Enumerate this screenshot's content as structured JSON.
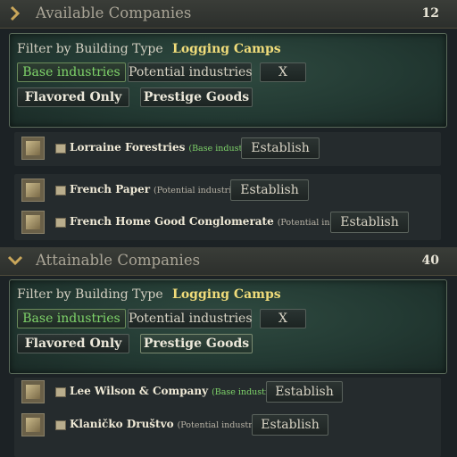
{
  "available": {
    "title": "Available Companies",
    "count": "12",
    "filter_label": "Filter by Building Type",
    "filter_value": "Logging Camps",
    "buttons": {
      "base": "Base industries",
      "potential": "Potential industries",
      "clear": "X",
      "flavored": "Flavored Only",
      "prestige": "Prestige Goods"
    },
    "companies": [
      {
        "name": "Lorraine Forestries",
        "tag": "(Base industries)",
        "action": "Establish"
      },
      {
        "name": "French Paper",
        "tag": "(Potential industries)",
        "action": "Establish"
      },
      {
        "name": "French Home Good Conglomerate",
        "tag": "(Potential industries)",
        "action": "Establish"
      }
    ]
  },
  "attainable": {
    "title": "Attainable Companies",
    "count": "40",
    "filter_label": "Filter by Building Type",
    "filter_value": "Logging Camps",
    "buttons": {
      "base": "Base industries",
      "potential": "Potential industries",
      "clear": "X",
      "flavored": "Flavored Only",
      "prestige": "Prestige Goods"
    },
    "companies": [
      {
        "name": "Lee Wilson & Company",
        "tag": "(Base industries)",
        "action": "Establish"
      },
      {
        "name": "Klaničko Društvo",
        "tag": "(Potential industries)",
        "action": "Establish"
      }
    ]
  },
  "colors": {
    "accent_green": "#7fd46a",
    "gold": "#f0dc7a"
  },
  "icons": {
    "collapse": "chevron-right-icon",
    "expand": "chevron-down-icon"
  }
}
